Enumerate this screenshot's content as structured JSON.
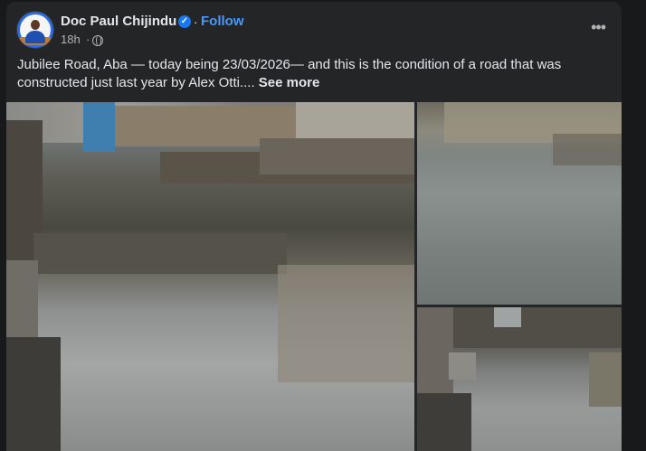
{
  "post": {
    "author": "Doc Paul Chijindu",
    "follow_label": "Follow",
    "time": "18h",
    "caption": "Jubilee Road, Aba — today being 23/03/2026— and this is the condition of a road that was constructed just last year by Alex Otti....",
    "see_more": "See more"
  },
  "icons": {
    "verified": "verified-badge-icon",
    "privacy": "globe-icon",
    "more": "more-options-icon"
  },
  "colors": {
    "background": "#18191a",
    "card": "#242526",
    "primary_text": "#e4e6eb",
    "secondary_text": "#b0b3b8",
    "link": "#4599ff",
    "verified": "#1877f2"
  },
  "photos": {
    "count": 3
  }
}
